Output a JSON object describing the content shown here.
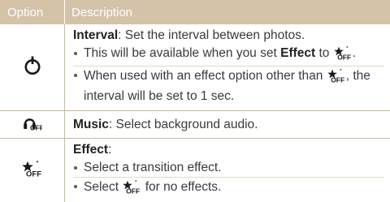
{
  "header": {
    "col_option": "Option",
    "col_description": "Description"
  },
  "rows": [
    {
      "icon": "timer-off-icon",
      "title": "Interval",
      "title_rest": ": Set the interval between photos.",
      "bullets": [
        {
          "pre": "This will be available when you set ",
          "bold": "Effect",
          "mid": " to ",
          "icon": "effect-off-icon",
          "post": "."
        },
        {
          "pre": "When used with an effect option other than ",
          "icon": "effect-off-icon",
          "post": ", the interval will be set to 1 sec."
        }
      ]
    },
    {
      "icon": "music-off-icon",
      "title": "Music",
      "title_rest": ": Select background audio."
    },
    {
      "icon": "effect-off-icon",
      "title": "Effect",
      "title_rest": ":",
      "bullets": [
        {
          "text": "Select a transition effect."
        },
        {
          "pre": "Select ",
          "icon": "effect-off-icon",
          "post": " for no effects."
        }
      ]
    }
  ]
}
